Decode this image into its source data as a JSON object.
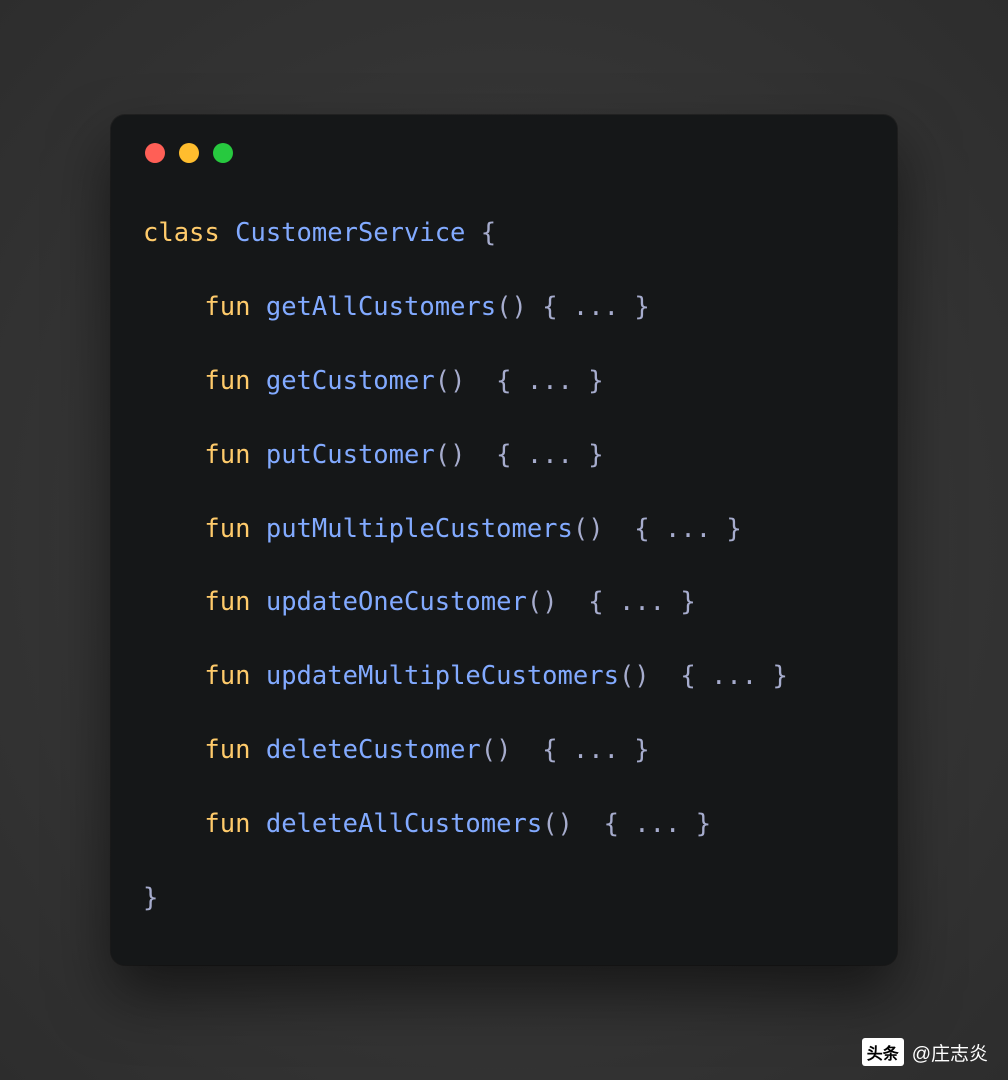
{
  "code": {
    "class_keyword": "class",
    "class_name": "CustomerService",
    "open_brace": " {",
    "fun_keyword": "fun",
    "body_suffix": "()",
    "body_suffix_padded": "() ",
    "body_braces": " { ... }",
    "functions": [
      "getAllCustomers",
      "getCustomer",
      "putCustomer",
      "putMultipleCustomers",
      "updateOneCustomer",
      "updateMultipleCustomers",
      "deleteCustomer",
      "deleteAllCustomers"
    ],
    "close_brace": "}"
  },
  "watermark": {
    "logo": "头条",
    "text": "@庄志炎"
  }
}
